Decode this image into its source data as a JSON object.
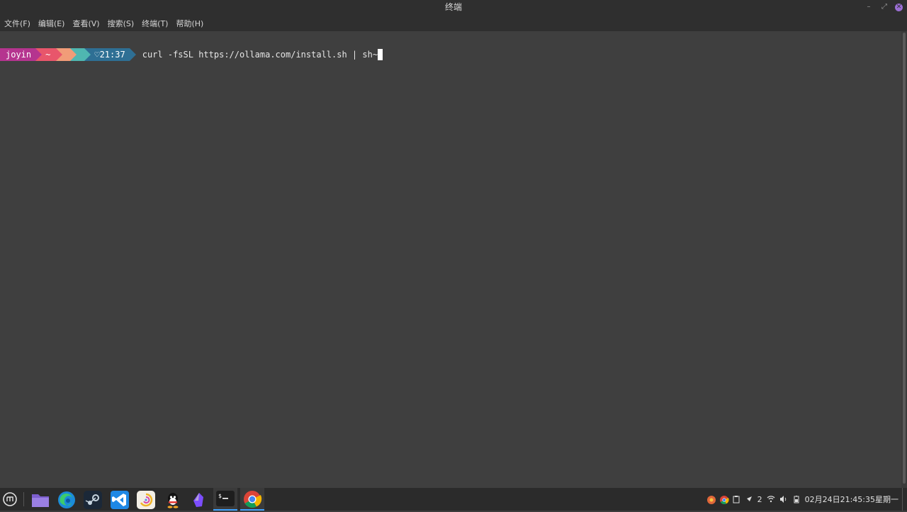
{
  "window": {
    "title": "终端",
    "controls": [
      "minimize",
      "maximize",
      "close"
    ]
  },
  "menu": {
    "items": [
      "文件(F)",
      "编辑(E)",
      "查看(V)",
      "搜索(S)",
      "终端(T)",
      "帮助(H)"
    ]
  },
  "prompt": {
    "user": "joyin",
    "dir": "~",
    "time": "♡21:37",
    "command": "curl -fsSL https://ollama.com/install.sh | sh~"
  },
  "taskbar": {
    "apps": [
      "menu-icon",
      "files-icon",
      "edge-icon",
      "steam-icon",
      "vscode-icon",
      "ace-icon",
      "qq-icon",
      "obsidian-icon",
      "terminal-icon",
      "chrome-icon"
    ]
  },
  "tray": {
    "notification_count": "2",
    "clock": "02月24日21:45:35星期一"
  },
  "colors": {
    "user_segment": "#b5348f",
    "dir_segment": "#e8566b",
    "segment_a": "#f19c78",
    "segment_b": "#4fb7b1",
    "time_segment": "#2e6f94",
    "terminal_bg": "#3f3f3f",
    "active_indicator": "#3fa3ff"
  }
}
